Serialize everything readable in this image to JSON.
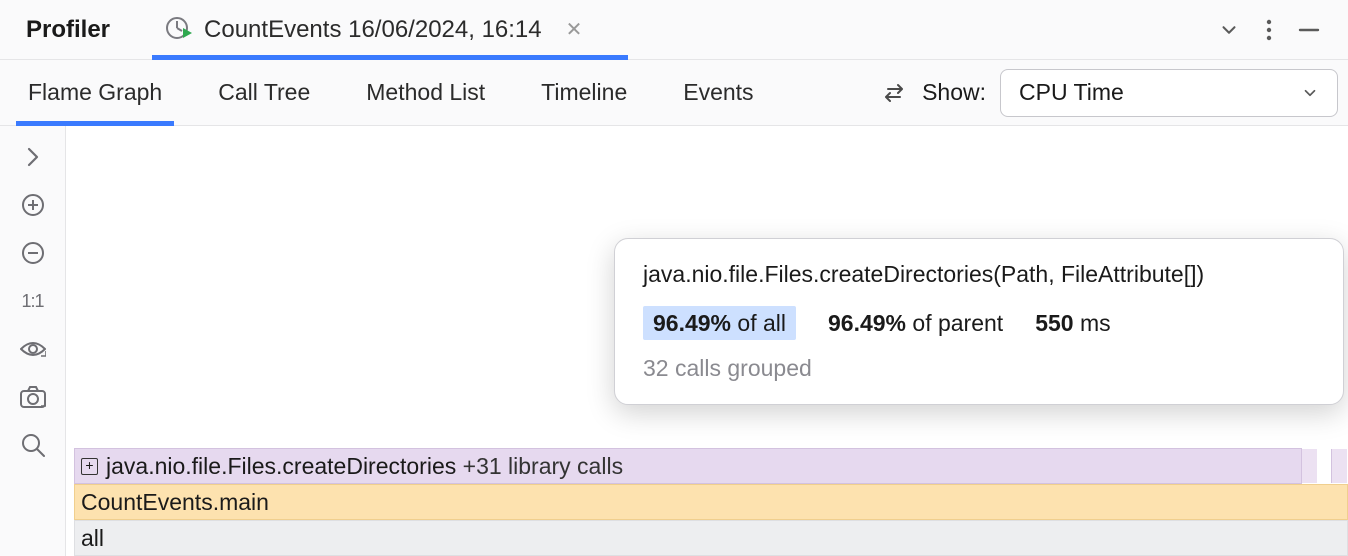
{
  "header": {
    "title": "Profiler",
    "session_label": "CountEvents 16/06/2024, 16:14"
  },
  "tabs": {
    "t0": "Flame Graph",
    "t1": "Call Tree",
    "t2": "Method List",
    "t3": "Timeline",
    "t4": "Events"
  },
  "show": {
    "label": "Show:",
    "value": "CPU Time"
  },
  "left_rail": {
    "ratio_label": "1:1"
  },
  "tooltip": {
    "method": "java.nio.file.Files.createDirectories(Path, FileAttribute[])",
    "pct_all_value": "96.49%",
    "pct_all_suffix": " of all",
    "pct_parent_value": "96.49%",
    "pct_parent_suffix": " of parent",
    "time_value": "550",
    "time_unit": " ms",
    "footer": "32 calls grouped"
  },
  "flame": {
    "row0_method": "java.nio.file.Files.createDirectories",
    "row0_suffix": "  +31 library calls",
    "row1": "CountEvents.main",
    "row2": "all"
  }
}
